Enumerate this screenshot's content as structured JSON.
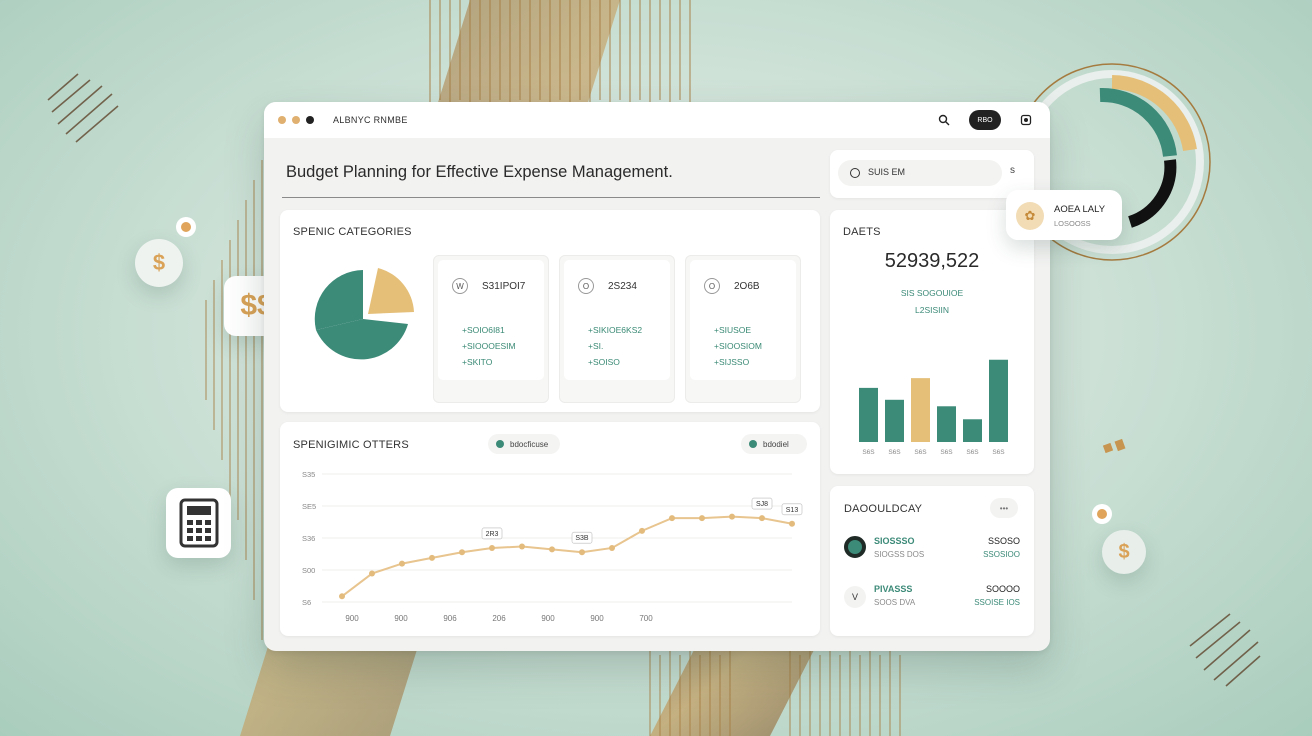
{
  "window": {
    "app_title": "ALBNYC RNMBE",
    "header_button": "RBO",
    "heading": "Budget Planning for Effective Expense Management.",
    "search": {
      "value": "SUIS EM",
      "side_icon": "s"
    }
  },
  "spending_categories": {
    "title": "SPENIC CATEGORIES",
    "cards": [
      {
        "icon": "W",
        "title": "S31IPOI7",
        "lines": [
          "+SOIO6I81",
          "+SIOOOESIM",
          "+SKITO"
        ]
      },
      {
        "icon": "O",
        "title": "2S234",
        "lines": [
          "+SIKIOE6KS2",
          "+SI.",
          "+SOISO"
        ]
      },
      {
        "icon": "O",
        "title": "2O6B",
        "lines": [
          "+SIUSOE",
          "+SIOOSIOM",
          "+SIJSSO"
        ]
      }
    ]
  },
  "spending_others": {
    "title": "SPENIGIMIC OTTERS",
    "legend": [
      "bdocficuse",
      "bdodiel"
    ],
    "chart_data": {
      "type": "line",
      "x": [
        "900",
        "900",
        "906",
        "206",
        "900",
        "900",
        "700"
      ],
      "y_ticks": [
        "S35",
        "SE5",
        "S36",
        "S00",
        "S6"
      ],
      "annotations": [
        "2R3",
        "SJ8",
        "S3B",
        "S13"
      ],
      "series_values": [
        4,
        20,
        27,
        31,
        35,
        38,
        39,
        37,
        35,
        38,
        50,
        59,
        59,
        60,
        59,
        55
      ],
      "ylim": [
        0,
        90
      ]
    }
  },
  "dacts": {
    "title": "DAETS",
    "big_value": "52939,522",
    "sub1": "SIS SOGOUIOE",
    "sub2": "L2SISIIN",
    "chart_data": {
      "type": "bar",
      "categories": [
        "S6S",
        "S6S",
        "S6S",
        "S6S",
        "S6S",
        "S6S"
      ],
      "values": [
        50,
        39,
        59,
        33,
        21,
        76
      ],
      "ylim": [
        0,
        85
      ]
    }
  },
  "daoulday": {
    "title": "DAOOULDCAY",
    "more": "•••",
    "rows": [
      {
        "avatar": "",
        "name": "SIOSSSO",
        "sub": "SIOGSS DOS",
        "amount": "SSOSO",
        "amount_sub": "SSOSIOO"
      },
      {
        "avatar": "V",
        "name": "PIVASSS",
        "sub": "SOOS DVA",
        "amount": "SOOOO",
        "amount_sub": "SSOISE IOS"
      }
    ]
  },
  "profile_chip": {
    "name": "AOEA LALY",
    "sub": "LOSOOSS"
  },
  "colors": {
    "teal": "#3c8a78",
    "gold": "#e5bf78",
    "bronze": "#a57b3f",
    "mint_bg": "#cfe2d8"
  },
  "icons": {
    "dollar": "$",
    "calculator": "calculator-icon"
  }
}
